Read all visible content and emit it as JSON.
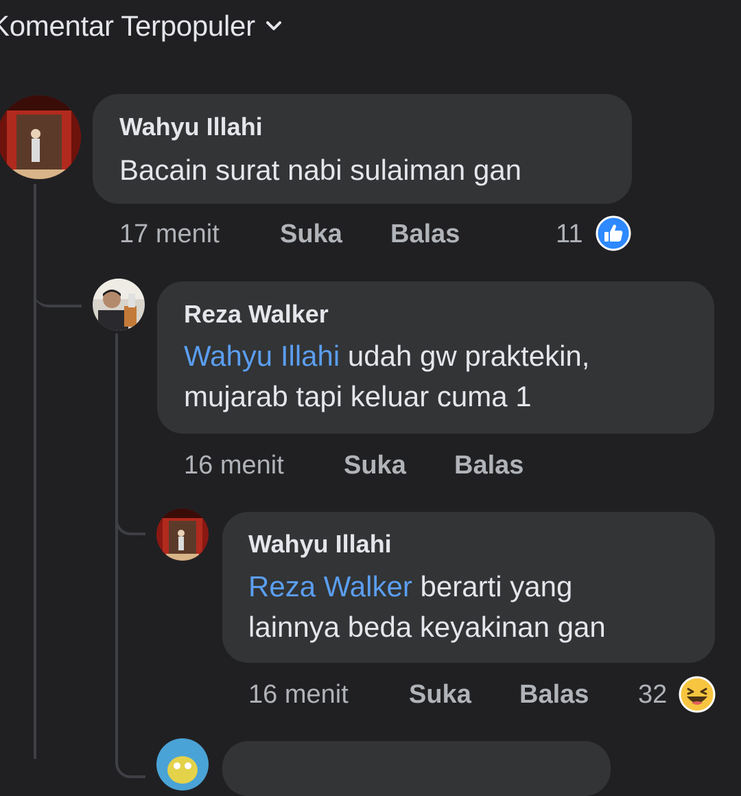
{
  "header": {
    "sort_label": "Komentar Terpopuler",
    "sort_icon": "chevron-down-icon"
  },
  "comments": [
    {
      "author": "Wahyu Illahi",
      "text": "Bacain surat nabi sulaiman gan",
      "time": "17 menit",
      "like_label": "Suka",
      "reply_label": "Balas",
      "reaction_count": "11",
      "reaction_icon": "like-icon"
    },
    {
      "author": "Reza Walker",
      "mention": "Wahyu Illahi",
      "text_line1": " udah gw praktekin,",
      "text_line2": "mujarab tapi keluar cuma 1",
      "time": "16 menit",
      "like_label": "Suka",
      "reply_label": "Balas"
    },
    {
      "author": "Wahyu Illahi",
      "mention": "Reza Walker",
      "text_line1": " berarti yang",
      "text_line2": "lainnya beda keyakinan gan",
      "time": "16 menit",
      "like_label": "Suka",
      "reply_label": "Balas",
      "reaction_count": "32",
      "reaction_icon": "haha-icon"
    }
  ],
  "colors": {
    "background": "#202023",
    "bubble": "#323436",
    "mention": "#5b9ef0",
    "like_blue": "#2e89ff",
    "haha_yellow": "#f7c53f"
  }
}
